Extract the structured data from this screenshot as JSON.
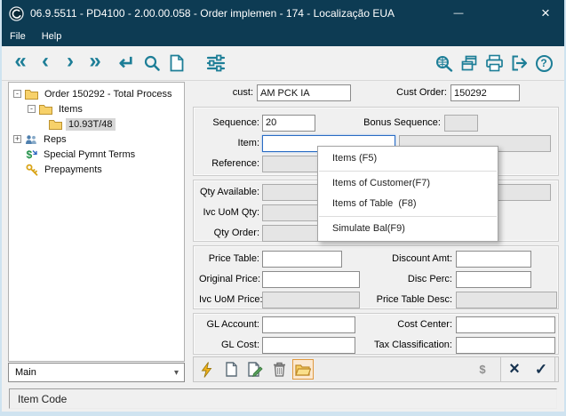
{
  "titlebar": {
    "title": "06.9.5511 - PD4100 - 2.00.00.058 - Order implemen - 174 - Localização EUA",
    "minimize_glyph": "—",
    "close_glyph": "×"
  },
  "menubar": {
    "items": [
      "File",
      "Help"
    ]
  },
  "toolbar": {
    "first_glyph": "«",
    "prev_glyph": "‹",
    "next_glyph": "›",
    "last_glyph": "»",
    "enter_glyph": "↵",
    "help_glyph": "?",
    "icons": [
      "first",
      "prev",
      "next",
      "last",
      "enter",
      "search",
      "new-document",
      "filter-settings",
      "zoom-search",
      "cascade-windows",
      "print",
      "exit",
      "help"
    ]
  },
  "tree": {
    "items": [
      {
        "label": "Order 150292 - Total Process",
        "expanded": "-"
      },
      {
        "label": "Items",
        "expanded": "-"
      },
      {
        "label": "10.93T/48",
        "selected": true
      },
      {
        "label": "Reps",
        "expanded": "+"
      },
      {
        "label": "Special Pymnt Terms"
      },
      {
        "label": "Prepayments"
      }
    ],
    "view_selector": "Main",
    "chevron_glyph": "▾"
  },
  "form": {
    "cust": {
      "label": "cust:",
      "value": "AM PCK IA"
    },
    "cust_order": {
      "label": "Cust Order:",
      "value": "150292"
    },
    "sequence": {
      "label": "Sequence:",
      "value": "20"
    },
    "bonus_sequence": {
      "label": "Bonus Sequence:",
      "value": ""
    },
    "item": {
      "label": "Item:",
      "value": ""
    },
    "item_desc": {
      "value": ""
    },
    "reference": {
      "label": "Reference:",
      "value": ""
    },
    "qty_available": {
      "label": "Qty Available:",
      "value": ""
    },
    "qty_available_uom": {
      "value": ""
    },
    "ivc_uom_qty": {
      "label": "Ivc UoM Qty:",
      "value": ""
    },
    "qty_order": {
      "label": "Qty Order:",
      "value": ""
    },
    "price_table": {
      "label": "Price Table:",
      "value": ""
    },
    "discount_amt": {
      "label": "Discount Amt:",
      "value": ""
    },
    "original_price": {
      "label": "Original Price:",
      "value": ""
    },
    "disc_perc": {
      "label": "Disc Perc:",
      "value": ""
    },
    "ivc_uom_price": {
      "label": "Ivc UoM Price:",
      "value": ""
    },
    "price_table_desc": {
      "label": "Price Table Desc:",
      "value": ""
    },
    "gl_account": {
      "label": "GL Account:",
      "value": ""
    },
    "cost_center": {
      "label": "Cost Center:",
      "value": ""
    },
    "gl_cost": {
      "label": "GL Cost:",
      "value": ""
    },
    "tax_classification": {
      "label": "Tax Classification:",
      "value": ""
    }
  },
  "context_menu": {
    "items": [
      "Items (F5)",
      "Items of Customer(F7)",
      "Items of Table  (F8)",
      "Simulate Bal(F9)"
    ]
  },
  "actionbar": {
    "icons": [
      "lightning",
      "new-record",
      "edit-record",
      "delete",
      "open-folder",
      "dollar",
      "cancel",
      "confirm"
    ],
    "dollar_glyph": "$",
    "cancel_glyph": "×",
    "confirm_glyph": "✓"
  },
  "statusbar": {
    "text": "Item Code"
  }
}
